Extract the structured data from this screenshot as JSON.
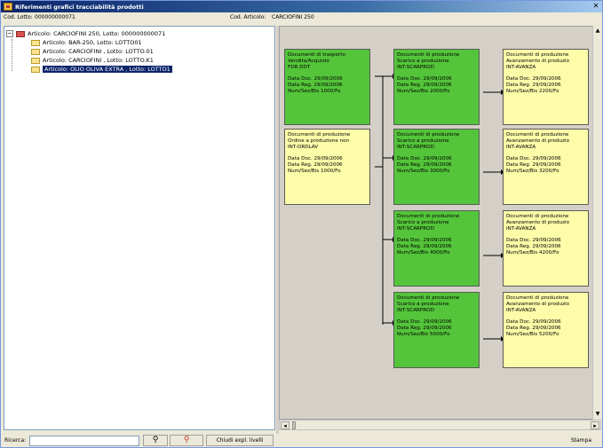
{
  "window": {
    "title": "Riferimenti grafici tracciabilità prodotti"
  },
  "infobar": {
    "lotto_label": "Cod. Lotto:",
    "lotto_value": "000000000071",
    "articolo_label": "Cod. Articolo:",
    "articolo_value": "CARCIOFINI 250"
  },
  "tree": {
    "root": "Articolo: CARCIOFINI 250, Lotto: 000000000071",
    "children": [
      "Articolo: BAR-250, Lotto: LOTTO01",
      "Articolo: CARCIOFINI , Lotto: LOTTO.01",
      "Articolo: CARCIOFINI , Lotto: LOTTO.K1",
      "Articolo: OLIO OLIVA EXTRA , Lotto: LOTTO1"
    ],
    "selected_index": 3
  },
  "nodes": [
    {
      "id": "n1",
      "color": "green",
      "lines": [
        "Documenti di trasporto",
        "Vendita/Acquisto",
        "FOR DDT"
      ],
      "date_lines": [
        "Data Doc.  29/09/2006",
        "Data Reg.  29/09/2006",
        "Num/Sez/Bis  1000/Fo"
      ]
    },
    {
      "id": "n2",
      "color": "yellow",
      "lines": [
        "Documenti di produzione",
        "Ordine a produzione non",
        "INT-ORDLAV"
      ],
      "date_lines": [
        "Data Doc.  29/09/2006",
        "Data Reg.  29/09/2006",
        "Num/Sez/Bis  1000/Fo"
      ]
    },
    {
      "id": "n3",
      "color": "green",
      "lines": [
        "Documenti di produzione",
        "Scarico a produzione",
        "INT-SCARPROD"
      ],
      "date_lines": [
        "Data Doc.  29/09/2006",
        "Data Reg.  29/09/2006",
        "Num/Sez/Bis  2000/Fo"
      ]
    },
    {
      "id": "n4",
      "color": "yellow",
      "lines": [
        "Documenti di produzione",
        "Avanzamento di produzio",
        "INT-AVANZA"
      ],
      "date_lines": [
        "Data Doc.  29/09/2006",
        "Data Reg.  29/09/2006",
        "Num/Sez/Bis  2200/Fo"
      ]
    },
    {
      "id": "n5",
      "color": "green",
      "lines": [
        "Documenti di produzione",
        "Scarico a produzione",
        "INT-SCARPROD"
      ],
      "date_lines": [
        "Data Doc.  29/09/2006",
        "Data Reg.  29/09/2006",
        "Num/Sez/Bis  3000/Fo"
      ]
    },
    {
      "id": "n6",
      "color": "yellow",
      "lines": [
        "Documenti di produzione",
        "Avanzamento di produzio",
        "INT-AVANZA"
      ],
      "date_lines": [
        "Data Doc.  29/09/2006",
        "Data Reg.  29/09/2006",
        "Num/Sez/Bis  3200/Fo"
      ]
    },
    {
      "id": "n7",
      "color": "green",
      "lines": [
        "Documenti di produzione",
        "Scarico a produzione",
        "INT-SCARPROD"
      ],
      "date_lines": [
        "Data Doc.  29/09/2006",
        "Data Reg.  29/09/2006",
        "Num/Sez/Bis  4000/Fo"
      ]
    },
    {
      "id": "n8",
      "color": "yellow",
      "lines": [
        "Documenti di produzione",
        "Avanzamento di produzio",
        "INT-AVANZA"
      ],
      "date_lines": [
        "Data Doc.  29/09/2006",
        "Data Reg.  29/09/2006",
        "Num/Sez/Bis  4200/Fo"
      ]
    },
    {
      "id": "n9",
      "color": "green",
      "lines": [
        "Documenti di produzione",
        "Scarico a produzione",
        "INT-SCARPROD"
      ],
      "date_lines": [
        "Data Doc.  29/09/2006",
        "Data Reg.  29/09/2006",
        "Num/Sez/Bis  5000/Fo"
      ]
    },
    {
      "id": "n10",
      "color": "yellow",
      "lines": [
        "Documenti di produzione",
        "Avanzamento di produzio",
        "INT-AVANZA"
      ],
      "date_lines": [
        "Data Doc.  29/09/2006",
        "Data Reg.  29/09/2006",
        "Num/Sez/Bis  5200/Fo"
      ]
    }
  ],
  "bottombar": {
    "search_label": "Ricerca:",
    "search_value": "",
    "find_icon": "binoculars-icon",
    "find_next_icon": "binoculars-red-icon",
    "collapse_label": "Chiudi expl. livelli",
    "print_label": "Stampa"
  },
  "colors": {
    "green_node": "#54c53a",
    "yellow_node": "#fdfca9",
    "selection": "#0a246a"
  }
}
